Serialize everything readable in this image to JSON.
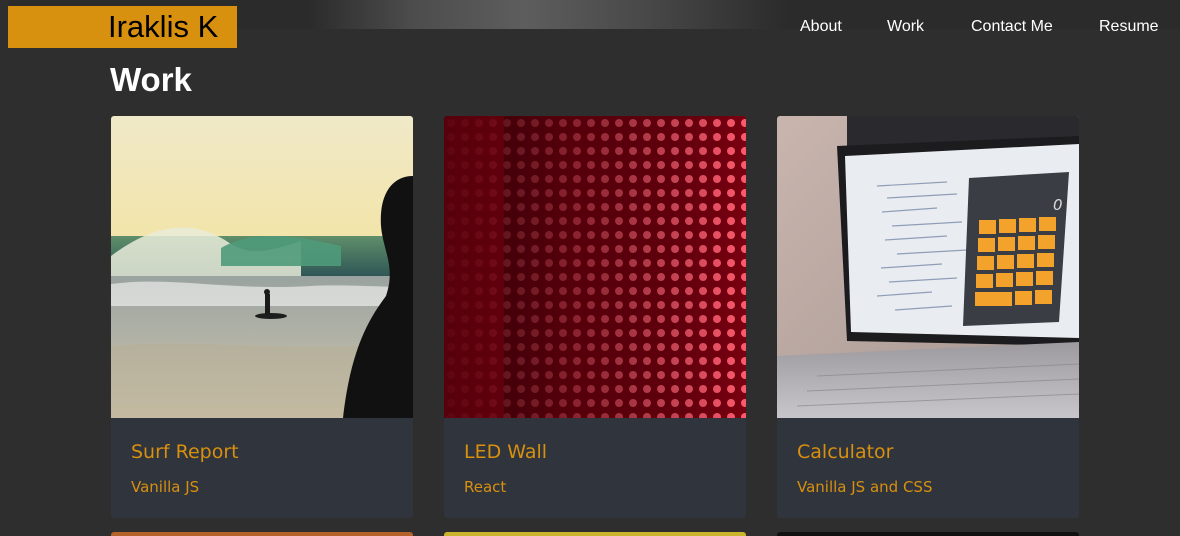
{
  "header": {
    "logo_text": "Iraklis K",
    "nav": [
      {
        "label": "About"
      },
      {
        "label": "Work"
      },
      {
        "label": "Contact Me"
      },
      {
        "label": "Resume"
      }
    ]
  },
  "main": {
    "section_title": "Work",
    "projects": [
      {
        "title": "Surf Report",
        "tech": "Vanilla JS",
        "image": "surfer-at-sunset-photo"
      },
      {
        "title": "LED Wall",
        "tech": "React",
        "image": "red-led-wall-photo"
      },
      {
        "title": "Calculator",
        "tech": "Vanilla JS and CSS",
        "image": "laptop-calculator-code-photo"
      }
    ]
  },
  "colors": {
    "accent": "#d8900f",
    "background": "#2e2e2e",
    "card": "#2f343d",
    "text": "#ffffff"
  }
}
